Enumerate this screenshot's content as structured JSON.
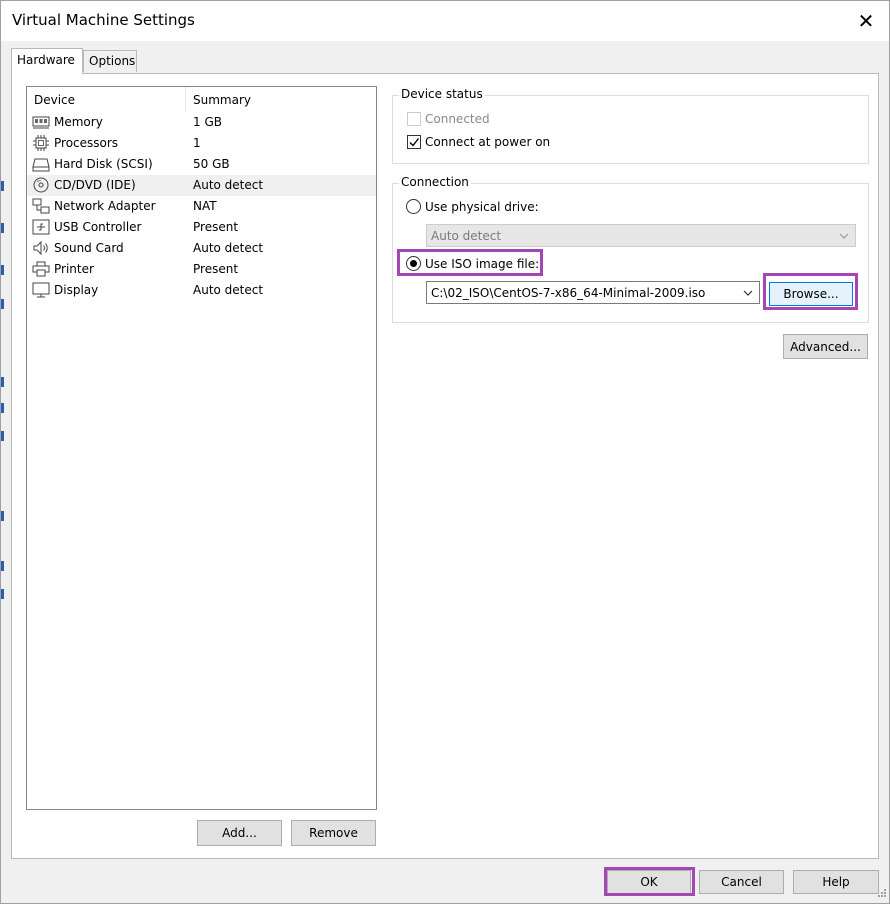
{
  "window": {
    "title": "Virtual Machine Settings",
    "close_glyph": "✕"
  },
  "tabs": [
    {
      "label": "Hardware",
      "active": true
    },
    {
      "label": "Options",
      "active": false
    }
  ],
  "device_list": {
    "columns": [
      "Device",
      "Summary"
    ],
    "rows": [
      {
        "name": "Memory",
        "summary": "1 GB",
        "icon": "memory-icon"
      },
      {
        "name": "Processors",
        "summary": "1",
        "icon": "processor-icon"
      },
      {
        "name": "Hard Disk (SCSI)",
        "summary": "50 GB",
        "icon": "hard-disk-icon"
      },
      {
        "name": "CD/DVD (IDE)",
        "summary": "Auto detect",
        "icon": "cd-dvd-icon",
        "selected": true
      },
      {
        "name": "Network Adapter",
        "summary": "NAT",
        "icon": "network-adapter-icon"
      },
      {
        "name": "USB Controller",
        "summary": "Present",
        "icon": "usb-icon"
      },
      {
        "name": "Sound Card",
        "summary": "Auto detect",
        "icon": "speaker-icon"
      },
      {
        "name": "Printer",
        "summary": "Present",
        "icon": "printer-icon"
      },
      {
        "name": "Display",
        "summary": "Auto detect",
        "icon": "monitor-icon"
      }
    ],
    "add_label": "Add...",
    "remove_label": "Remove"
  },
  "device_status": {
    "legend": "Device status",
    "connected_label": "Connected",
    "connected_checked": false,
    "connected_disabled": true,
    "power_on_label": "Connect at power on",
    "power_on_checked": true
  },
  "connection": {
    "legend": "Connection",
    "physical_label": "Use physical drive:",
    "physical_selected": false,
    "physical_value": "Auto detect",
    "iso_label": "Use ISO image file:",
    "iso_selected": true,
    "iso_path": "C:\\02_ISO\\CentOS-7-x86_64-Minimal-2009.iso",
    "browse_label": "Browse...",
    "advanced_label": "Advanced..."
  },
  "footer": {
    "ok_label": "OK",
    "cancel_label": "Cancel",
    "help_label": "Help"
  },
  "colors": {
    "highlight": "#a545b6",
    "focus_blue": "#0078d7"
  }
}
